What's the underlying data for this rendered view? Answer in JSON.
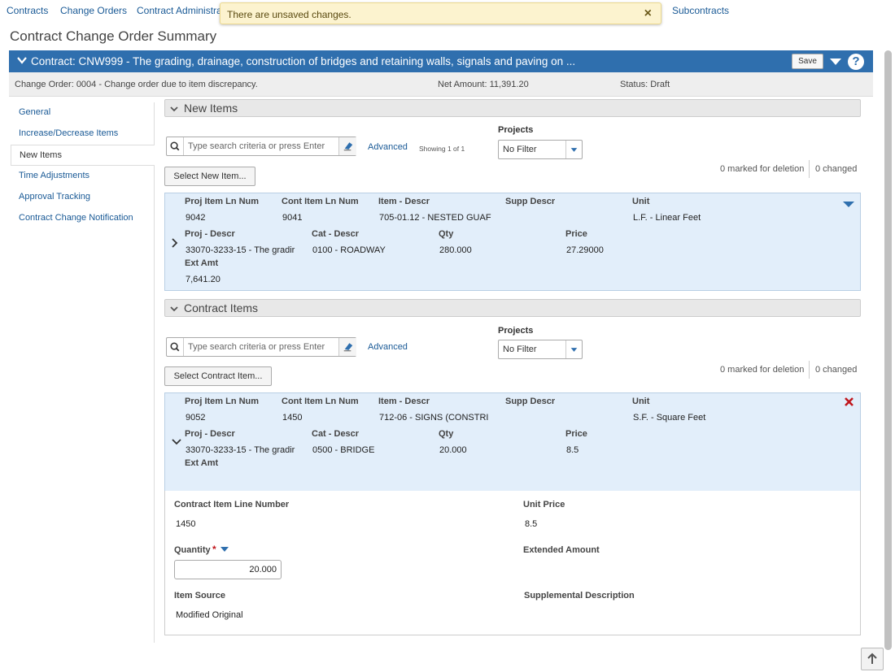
{
  "topnav": [
    "Contracts",
    "Change Orders",
    "Contract Administrati",
    "Subcontracts"
  ],
  "toast": {
    "message": "There are unsaved changes.",
    "close": "×"
  },
  "page_title": "Contract Change Order Summary",
  "contract_bar": {
    "title": "Contract: CNW999 - The grading, drainage, construction of bridges and retaining walls, signals and paving on ...",
    "save_label": "Save",
    "help": "?"
  },
  "info": {
    "change_order": "Change Order: 0004 - Change order due to item discrepancy.",
    "net_amount": "Net Amount: 11,391.20",
    "status": "Status: Draft"
  },
  "left_nav": [
    "General",
    "Increase/Decrease Items",
    "New Items",
    "Time Adjustments",
    "Approval Tracking",
    "Contract Change Notification"
  ],
  "new_items": {
    "section_label": "New Items",
    "search_placeholder": "Type search criteria or press Enter",
    "advanced": "Advanced",
    "showing": "Showing 1 of 1",
    "projects_label": "Projects",
    "projects_value": "No Filter",
    "select_button": "Select New Item...",
    "marked": "0 marked for deletion",
    "changed": "0 changed",
    "headers": {
      "proj_item": "Proj Item Ln Num",
      "cont_item": "Cont Item Ln Num",
      "item_descr": "Item - Descr",
      "supp_descr": "Supp Descr",
      "unit": "Unit",
      "proj_descr": "Proj - Descr",
      "cat_descr": "Cat - Descr",
      "qty": "Qty",
      "price": "Price",
      "ext_amt": "Ext Amt"
    },
    "row": {
      "proj_item": "9042",
      "cont_item": "9041",
      "item_descr": "705-01.12 - NESTED GUAF",
      "supp_descr": "",
      "unit": "L.F. - Linear Feet",
      "proj_descr": "33070-3233-15 - The gradir",
      "cat_descr": "0100 - ROADWAY",
      "qty": "280.000",
      "price": "27.29000",
      "ext_amt": "7,641.20"
    }
  },
  "contract_items": {
    "section_label": "Contract Items",
    "search_placeholder": "Type search criteria or press Enter",
    "advanced": "Advanced",
    "projects_label": "Projects",
    "projects_value": "No Filter",
    "select_button": "Select Contract Item...",
    "marked": "0 marked for deletion",
    "changed": "0 changed",
    "headers": {
      "proj_item": "Proj Item Ln Num",
      "cont_item": "Cont Item Ln Num",
      "item_descr": "Item - Descr",
      "supp_descr": "Supp Descr",
      "unit": "Unit",
      "proj_descr": "Proj - Descr",
      "cat_descr": "Cat - Descr",
      "qty": "Qty",
      "price": "Price",
      "ext_amt": "Ext Amt"
    },
    "row": {
      "proj_item": "9052",
      "cont_item": "1450",
      "item_descr": "712-06 - SIGNS (CONSTRI",
      "supp_descr": "",
      "unit": "S.F. - Square Feet",
      "proj_descr": "33070-3233-15 - The gradir",
      "cat_descr": "0500 - BRIDGE",
      "qty": "20.000",
      "price": "8.5",
      "ext_amt": ""
    },
    "detail": {
      "line_number_label": "Contract Item Line Number",
      "line_number": "1450",
      "unit_price_label": "Unit Price",
      "unit_price": "8.5",
      "quantity_label": "Quantity",
      "required_mark": "*",
      "quantity": "20.000",
      "extended_amount_label": "Extended Amount",
      "item_source_label": "Item Source",
      "item_source": "Modified Original",
      "supp_descr_label": "Supplemental Description"
    }
  },
  "colors": {
    "primary_blue": "#2f6fae",
    "card_blue": "#e2eefa",
    "toast_bg": "#fcf3cf",
    "delete_red": "#c0161c"
  }
}
